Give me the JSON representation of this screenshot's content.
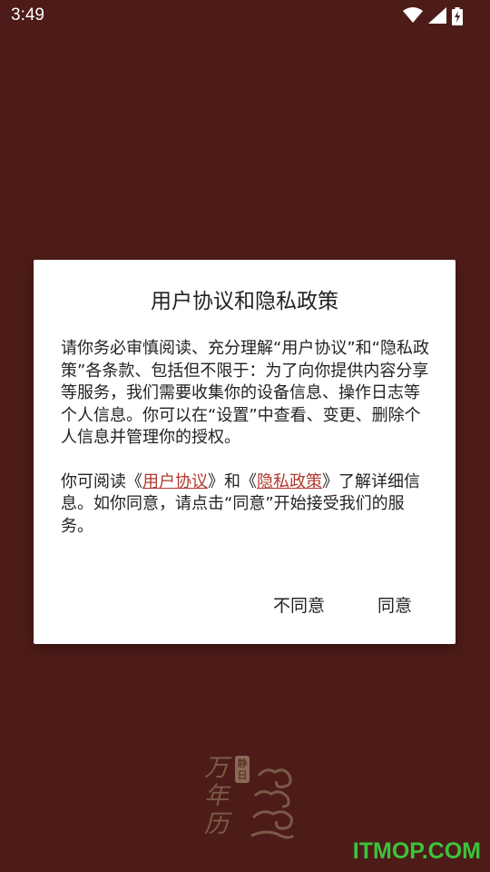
{
  "status_bar": {
    "time": "3:49",
    "icons": [
      "wifi-icon",
      "cellular-signal-icon",
      "battery-charging-icon"
    ]
  },
  "dialog": {
    "title": "用户协议和隐私政策",
    "paragraph1": "请你务必审慎阅读、充分理解“用户协议”和“隐私政策”各条款、包括但不限于：为了向你提供内容分享等服务，我们需要收集你的设备信息、操作日志等个人信息。你可以在“设置”中查看、变更、删除个人信息并管理你的授权。",
    "paragraph2": {
      "prefix": "你可阅读《",
      "link_user_agreement": "用户协议",
      "middle": "》和《",
      "link_privacy_policy": "隐私政策",
      "suffix": "》了解详细信息。如你同意，请点击“同意”开始接受我们的服务。"
    },
    "buttons": {
      "disagree": "不同意",
      "agree": "同意"
    }
  },
  "logo": {
    "text": "万年历",
    "badge": "静日"
  },
  "watermark": "ITMOP.COM",
  "colors": {
    "background": "#4e1c18",
    "link": "#b3382e",
    "watermark": "#3cc33c"
  }
}
